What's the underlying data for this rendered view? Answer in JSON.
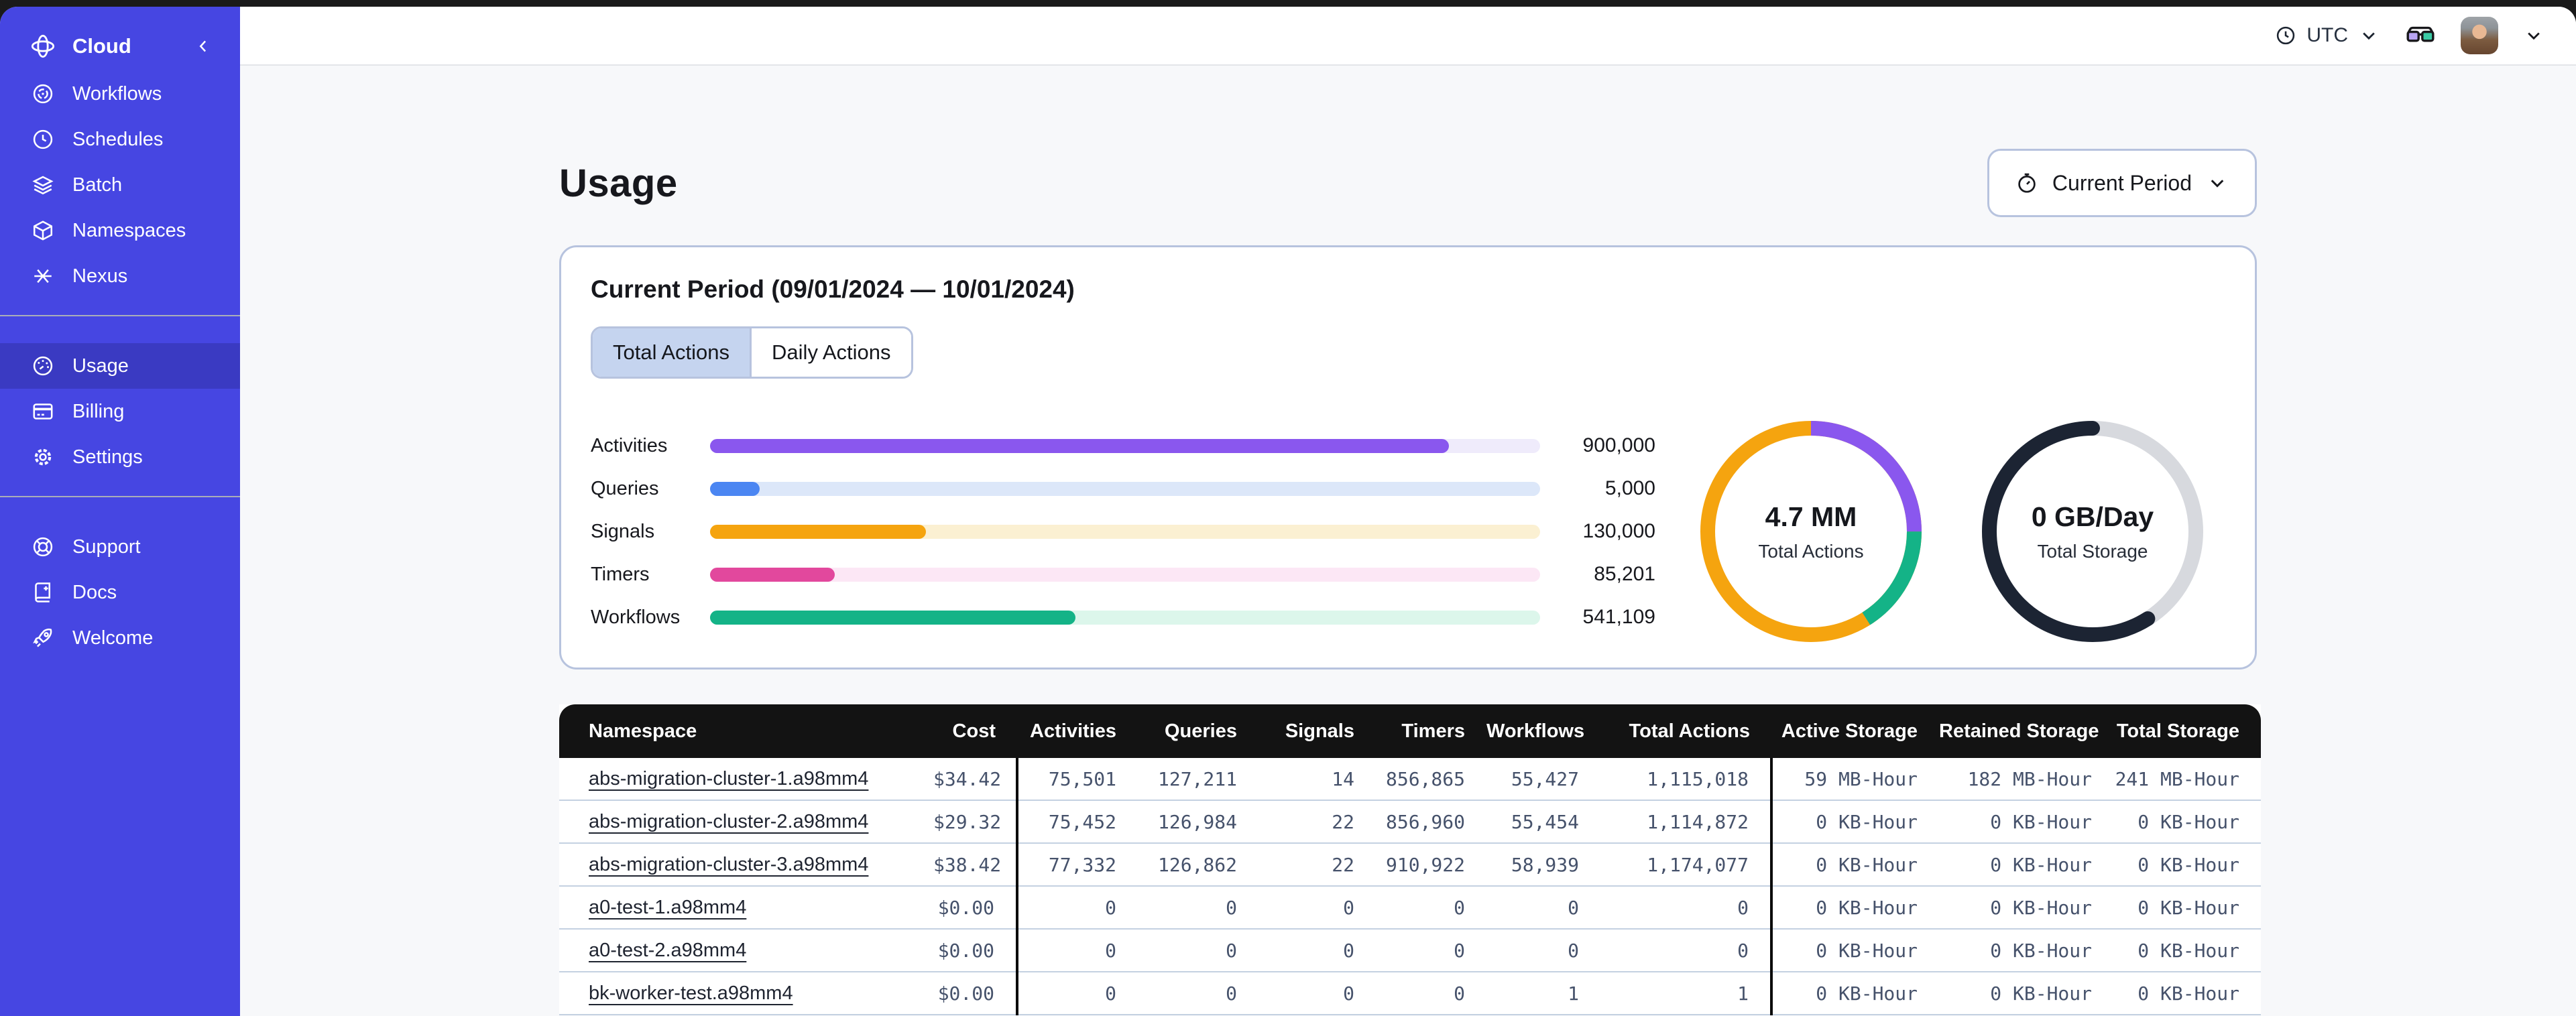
{
  "sidebar": {
    "brand_label": "Cloud",
    "nav_main": [
      {
        "label": "Workflows"
      },
      {
        "label": "Schedules"
      },
      {
        "label": "Batch"
      },
      {
        "label": "Namespaces"
      },
      {
        "label": "Nexus"
      }
    ],
    "nav_account": [
      {
        "label": "Usage",
        "active": true
      },
      {
        "label": "Billing"
      },
      {
        "label": "Settings"
      }
    ],
    "nav_footer": [
      {
        "label": "Support"
      },
      {
        "label": "Docs"
      },
      {
        "label": "Welcome"
      }
    ]
  },
  "topbar": {
    "timezone": "UTC"
  },
  "page": {
    "title": "Usage",
    "period_button_label": "Current Period",
    "card": {
      "title": "Current Period (09/01/2024 — 10/01/2024)",
      "tabs": [
        {
          "label": "Total Actions",
          "active": true
        },
        {
          "label": "Daily Actions",
          "active": false
        }
      ]
    }
  },
  "chart_data": [
    {
      "type": "bar",
      "orientation": "horizontal",
      "title": "Total Actions by type",
      "categories": [
        "Activities",
        "Queries",
        "Signals",
        "Timers",
        "Workflows"
      ],
      "values": [
        900000,
        5000,
        130000,
        85201,
        541109
      ],
      "value_labels": [
        "900,000",
        "5,000",
        "130,000",
        "85,201",
        "541,109"
      ],
      "display_pct": [
        89,
        6,
        26,
        15,
        44
      ],
      "colors": [
        "#8A57EE",
        "#4B86F2",
        "#F5A40F",
        "#E2489D",
        "#14B387"
      ],
      "track_colors": [
        "#EFEBFB",
        "#DCE7F9",
        "#FBF0D2",
        "#FCE7F5",
        "#DCF6EB"
      ]
    },
    {
      "type": "donut",
      "center_value": "4.7 MM",
      "center_label": "Total Actions",
      "base_color": "#F5A40F",
      "segments": [
        {
          "name": "activities",
          "color": "#8A57EE",
          "pct": 25,
          "offset": 0,
          "cap": "butt"
        },
        {
          "name": "workflows",
          "color": "#14B387",
          "pct": 16,
          "offset": 25,
          "cap": "butt"
        }
      ]
    },
    {
      "type": "donut",
      "center_value": "0 GB/Day",
      "center_label": "Total Storage",
      "base_color": "#D7D9DE",
      "segments": [
        {
          "name": "used",
          "color": "#1C2433",
          "pct": 59,
          "offset": 41,
          "cap": "round"
        }
      ]
    }
  ],
  "table": {
    "columns": [
      {
        "key": "namespace",
        "label": "Namespace"
      },
      {
        "key": "cost",
        "label": "Cost"
      },
      {
        "key": "activities",
        "label": "Activities"
      },
      {
        "key": "queries",
        "label": "Queries"
      },
      {
        "key": "signals",
        "label": "Signals"
      },
      {
        "key": "timers",
        "label": "Timers"
      },
      {
        "key": "workflows",
        "label": "Workflows"
      },
      {
        "key": "total_actions",
        "label": "Total Actions"
      },
      {
        "key": "active_storage",
        "label": "Active Storage"
      },
      {
        "key": "retained_storage",
        "label": "Retained Storage"
      },
      {
        "key": "total_storage",
        "label": "Total Storage"
      }
    ],
    "rows": [
      {
        "namespace": "abs-migration-cluster-1.a98mm4",
        "cost": "$34.42",
        "activities": "75,501",
        "queries": "127,211",
        "signals": "14",
        "timers": "856,865",
        "workflows": "55,427",
        "total_actions": "1,115,018",
        "active_storage": "59 MB-Hour",
        "retained_storage": "182 MB-Hour",
        "total_storage": "241 MB-Hour"
      },
      {
        "namespace": "abs-migration-cluster-2.a98mm4",
        "cost": "$29.32",
        "activities": "75,452",
        "queries": "126,984",
        "signals": "22",
        "timers": "856,960",
        "workflows": "55,454",
        "total_actions": "1,114,872",
        "active_storage": "0 KB-Hour",
        "retained_storage": "0 KB-Hour",
        "total_storage": "0 KB-Hour"
      },
      {
        "namespace": "abs-migration-cluster-3.a98mm4",
        "cost": "$38.42",
        "activities": "77,332",
        "queries": "126,862",
        "signals": "22",
        "timers": "910,922",
        "workflows": "58,939",
        "total_actions": "1,174,077",
        "active_storage": "0 KB-Hour",
        "retained_storage": "0 KB-Hour",
        "total_storage": "0 KB-Hour"
      },
      {
        "namespace": "a0-test-1.a98mm4",
        "cost": "$0.00",
        "activities": "0",
        "queries": "0",
        "signals": "0",
        "timers": "0",
        "workflows": "0",
        "total_actions": "0",
        "active_storage": "0 KB-Hour",
        "retained_storage": "0 KB-Hour",
        "total_storage": "0 KB-Hour"
      },
      {
        "namespace": "a0-test-2.a98mm4",
        "cost": "$0.00",
        "activities": "0",
        "queries": "0",
        "signals": "0",
        "timers": "0",
        "workflows": "0",
        "total_actions": "0",
        "active_storage": "0 KB-Hour",
        "retained_storage": "0 KB-Hour",
        "total_storage": "0 KB-Hour"
      },
      {
        "namespace": "bk-worker-test.a98mm4",
        "cost": "$0.00",
        "activities": "0",
        "queries": "0",
        "signals": "0",
        "timers": "0",
        "workflows": "1",
        "total_actions": "1",
        "active_storage": "0 KB-Hour",
        "retained_storage": "0 KB-Hour",
        "total_storage": "0 KB-Hour"
      }
    ]
  }
}
